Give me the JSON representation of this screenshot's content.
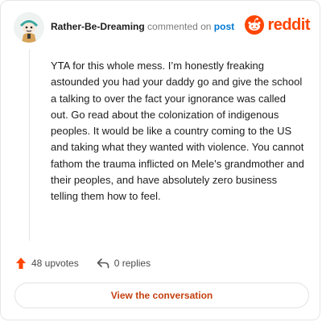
{
  "comment": {
    "username": "Rather-Be-Dreaming",
    "action_text": "commented on",
    "post_link_text": "post",
    "body": "YTA for this whole mess. I’m honestly freaking astounded you had your daddy go and give the school a talking to over the fact your ignorance was called out. Go read about the colonization of indigenous peoples. It would be like a country coming to the US and taking what they wanted with violence. You cannot fathom the trauma inflicted on Mele’s grandmother and their peoples, and have absolutely zero business telling them how to feel."
  },
  "brand": {
    "wordmark": "reddit",
    "color": "#ff4500",
    "icon": "reddit-snoo-icon"
  },
  "stats": {
    "upvotes": "48 upvotes",
    "replies": "0 replies",
    "upvote_icon": "upvote-arrow-icon",
    "reply_icon": "reply-arrow-icon",
    "upvote_color": "#ff4500"
  },
  "cta": {
    "label": "View the conversation"
  }
}
